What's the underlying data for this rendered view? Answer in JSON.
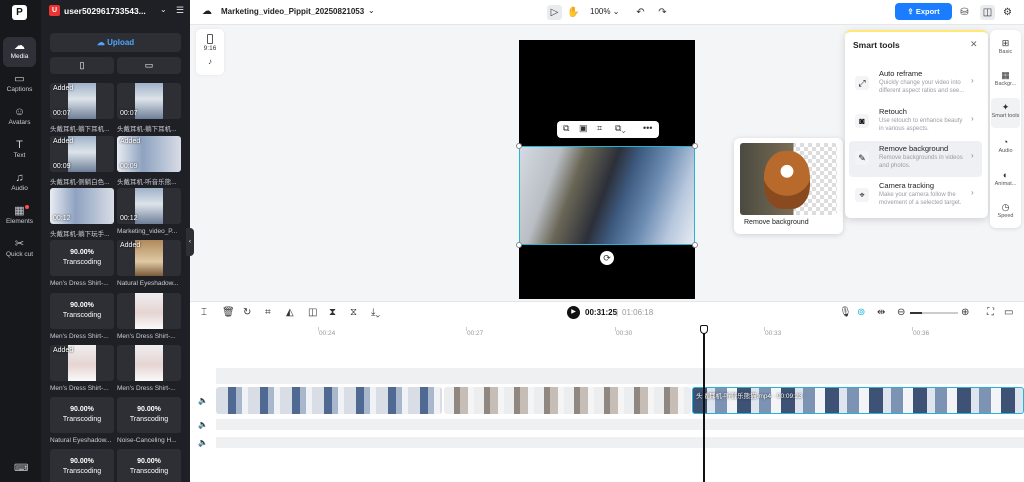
{
  "nav": {
    "logo": "P",
    "items": [
      {
        "label": "Media",
        "icon": "media-icon"
      },
      {
        "label": "Captions",
        "icon": "captions-icon"
      },
      {
        "label": "Avatars",
        "icon": "avatars-icon"
      },
      {
        "label": "Text",
        "icon": "text-icon"
      },
      {
        "label": "Audio",
        "icon": "audio-icon"
      },
      {
        "label": "Elements",
        "icon": "elements-icon"
      },
      {
        "label": "Quick cut",
        "icon": "quick-cut-icon"
      }
    ]
  },
  "media_panel": {
    "avatar_letter": "U",
    "username": "user502961733543...",
    "upload_label": "Upload",
    "tiles": [
      {
        "added": "Added",
        "duration": "00:07",
        "name": "头戴耳机-躺下耳机..."
      },
      {
        "added": "",
        "duration": "00:07",
        "name": "头戴耳机-躺下耳机..."
      },
      {
        "added": "Added",
        "duration": "00:09",
        "name": "头戴耳机-侧躺白色..."
      },
      {
        "added": "Added",
        "duration": "00:09",
        "name": "头戴耳机-听音乐熊..."
      },
      {
        "added": "",
        "duration": "00:12",
        "name": "头戴耳机-躺下玩手..."
      },
      {
        "added": "",
        "duration": "00:12",
        "name": "Marketing_video_P..."
      },
      {
        "percent": "90.00%",
        "status": "Transcoding",
        "name": "Men's Dress Shirt-..."
      },
      {
        "added": "Added",
        "duration": "",
        "name": "Natural Eyeshadow..."
      },
      {
        "percent": "90.00%",
        "status": "Transcoding",
        "name": "Men's Dress Shirt-..."
      },
      {
        "added": "",
        "duration": "",
        "name": "Men's Dress Shirt-..."
      },
      {
        "added": "Added",
        "duration": "",
        "name": "Men's Dress Shirt-..."
      },
      {
        "added": "",
        "duration": "",
        "name": "Men's Dress Shirt-..."
      },
      {
        "percent": "90.00%",
        "status": "Transcoding",
        "name": "Natural Eyeshadow..."
      },
      {
        "percent": "90.00%",
        "status": "Transcoding",
        "name": "Noise-Canceling H..."
      },
      {
        "percent": "90.00%",
        "status": "Transcoding",
        "name": ""
      },
      {
        "percent": "90.00%",
        "status": "Transcoding",
        "name": ""
      }
    ]
  },
  "topbar": {
    "project_title": "Marketing_video_Pippit_20250821053",
    "zoom": "100%",
    "export_label": "Export"
  },
  "canvas": {
    "ratio_label": "9:16"
  },
  "remove_bg_preview": {
    "label": "Remove background"
  },
  "smart_tools": {
    "title": "Smart tools",
    "items": [
      {
        "name": "Auto reframe",
        "desc": "Quickly change your video into different aspect ratios and see..."
      },
      {
        "name": "Retouch",
        "desc": "Use retouch to enhance beauty in various aspects."
      },
      {
        "name": "Remove background",
        "desc": "Remove backgrounds in videos and photos."
      },
      {
        "name": "Camera tracking",
        "desc": "Make your camera follow the movement of a selected target."
      }
    ]
  },
  "right_tabs": [
    {
      "label": "Basic",
      "icon": "basic-icon"
    },
    {
      "label": "Backgr...",
      "icon": "background-icon"
    },
    {
      "label": "Smart tools",
      "icon": "smart-tools-icon"
    },
    {
      "label": "Audio",
      "icon": "audio-icon"
    },
    {
      "label": "Animat...",
      "icon": "animation-icon"
    },
    {
      "label": "Speed",
      "icon": "speed-icon"
    }
  ],
  "timeline": {
    "current_time": "00:31:25",
    "separator": "|",
    "total_time": "01:06:18",
    "ticks": [
      "00:24",
      "00:27",
      "00:30",
      "00:33",
      "00:36"
    ],
    "selected_clip_label": "头戴耳机-听音乐熊猫.mp4 · 00:09:23"
  }
}
